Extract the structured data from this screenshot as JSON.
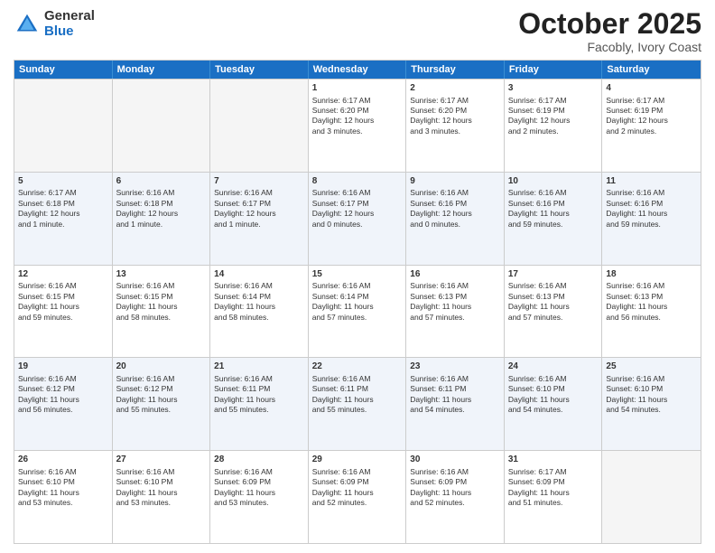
{
  "header": {
    "logo": {
      "general": "General",
      "blue": "Blue"
    },
    "title": "October 2025",
    "location": "Facobly, Ivory Coast"
  },
  "weekdays": [
    "Sunday",
    "Monday",
    "Tuesday",
    "Wednesday",
    "Thursday",
    "Friday",
    "Saturday"
  ],
  "rows": [
    [
      {
        "day": "",
        "empty": true
      },
      {
        "day": "",
        "empty": true
      },
      {
        "day": "",
        "empty": true
      },
      {
        "day": "1",
        "lines": [
          "Sunrise: 6:17 AM",
          "Sunset: 6:20 PM",
          "Daylight: 12 hours",
          "and 3 minutes."
        ]
      },
      {
        "day": "2",
        "lines": [
          "Sunrise: 6:17 AM",
          "Sunset: 6:20 PM",
          "Daylight: 12 hours",
          "and 3 minutes."
        ]
      },
      {
        "day": "3",
        "lines": [
          "Sunrise: 6:17 AM",
          "Sunset: 6:19 PM",
          "Daylight: 12 hours",
          "and 2 minutes."
        ]
      },
      {
        "day": "4",
        "lines": [
          "Sunrise: 6:17 AM",
          "Sunset: 6:19 PM",
          "Daylight: 12 hours",
          "and 2 minutes."
        ]
      }
    ],
    [
      {
        "day": "5",
        "lines": [
          "Sunrise: 6:17 AM",
          "Sunset: 6:18 PM",
          "Daylight: 12 hours",
          "and 1 minute."
        ]
      },
      {
        "day": "6",
        "lines": [
          "Sunrise: 6:16 AM",
          "Sunset: 6:18 PM",
          "Daylight: 12 hours",
          "and 1 minute."
        ]
      },
      {
        "day": "7",
        "lines": [
          "Sunrise: 6:16 AM",
          "Sunset: 6:17 PM",
          "Daylight: 12 hours",
          "and 1 minute."
        ]
      },
      {
        "day": "8",
        "lines": [
          "Sunrise: 6:16 AM",
          "Sunset: 6:17 PM",
          "Daylight: 12 hours",
          "and 0 minutes."
        ]
      },
      {
        "day": "9",
        "lines": [
          "Sunrise: 6:16 AM",
          "Sunset: 6:16 PM",
          "Daylight: 12 hours",
          "and 0 minutes."
        ]
      },
      {
        "day": "10",
        "lines": [
          "Sunrise: 6:16 AM",
          "Sunset: 6:16 PM",
          "Daylight: 11 hours",
          "and 59 minutes."
        ]
      },
      {
        "day": "11",
        "lines": [
          "Sunrise: 6:16 AM",
          "Sunset: 6:16 PM",
          "Daylight: 11 hours",
          "and 59 minutes."
        ]
      }
    ],
    [
      {
        "day": "12",
        "lines": [
          "Sunrise: 6:16 AM",
          "Sunset: 6:15 PM",
          "Daylight: 11 hours",
          "and 59 minutes."
        ]
      },
      {
        "day": "13",
        "lines": [
          "Sunrise: 6:16 AM",
          "Sunset: 6:15 PM",
          "Daylight: 11 hours",
          "and 58 minutes."
        ]
      },
      {
        "day": "14",
        "lines": [
          "Sunrise: 6:16 AM",
          "Sunset: 6:14 PM",
          "Daylight: 11 hours",
          "and 58 minutes."
        ]
      },
      {
        "day": "15",
        "lines": [
          "Sunrise: 6:16 AM",
          "Sunset: 6:14 PM",
          "Daylight: 11 hours",
          "and 57 minutes."
        ]
      },
      {
        "day": "16",
        "lines": [
          "Sunrise: 6:16 AM",
          "Sunset: 6:13 PM",
          "Daylight: 11 hours",
          "and 57 minutes."
        ]
      },
      {
        "day": "17",
        "lines": [
          "Sunrise: 6:16 AM",
          "Sunset: 6:13 PM",
          "Daylight: 11 hours",
          "and 57 minutes."
        ]
      },
      {
        "day": "18",
        "lines": [
          "Sunrise: 6:16 AM",
          "Sunset: 6:13 PM",
          "Daylight: 11 hours",
          "and 56 minutes."
        ]
      }
    ],
    [
      {
        "day": "19",
        "lines": [
          "Sunrise: 6:16 AM",
          "Sunset: 6:12 PM",
          "Daylight: 11 hours",
          "and 56 minutes."
        ]
      },
      {
        "day": "20",
        "lines": [
          "Sunrise: 6:16 AM",
          "Sunset: 6:12 PM",
          "Daylight: 11 hours",
          "and 55 minutes."
        ]
      },
      {
        "day": "21",
        "lines": [
          "Sunrise: 6:16 AM",
          "Sunset: 6:11 PM",
          "Daylight: 11 hours",
          "and 55 minutes."
        ]
      },
      {
        "day": "22",
        "lines": [
          "Sunrise: 6:16 AM",
          "Sunset: 6:11 PM",
          "Daylight: 11 hours",
          "and 55 minutes."
        ]
      },
      {
        "day": "23",
        "lines": [
          "Sunrise: 6:16 AM",
          "Sunset: 6:11 PM",
          "Daylight: 11 hours",
          "and 54 minutes."
        ]
      },
      {
        "day": "24",
        "lines": [
          "Sunrise: 6:16 AM",
          "Sunset: 6:10 PM",
          "Daylight: 11 hours",
          "and 54 minutes."
        ]
      },
      {
        "day": "25",
        "lines": [
          "Sunrise: 6:16 AM",
          "Sunset: 6:10 PM",
          "Daylight: 11 hours",
          "and 54 minutes."
        ]
      }
    ],
    [
      {
        "day": "26",
        "lines": [
          "Sunrise: 6:16 AM",
          "Sunset: 6:10 PM",
          "Daylight: 11 hours",
          "and 53 minutes."
        ]
      },
      {
        "day": "27",
        "lines": [
          "Sunrise: 6:16 AM",
          "Sunset: 6:10 PM",
          "Daylight: 11 hours",
          "and 53 minutes."
        ]
      },
      {
        "day": "28",
        "lines": [
          "Sunrise: 6:16 AM",
          "Sunset: 6:09 PM",
          "Daylight: 11 hours",
          "and 53 minutes."
        ]
      },
      {
        "day": "29",
        "lines": [
          "Sunrise: 6:16 AM",
          "Sunset: 6:09 PM",
          "Daylight: 11 hours",
          "and 52 minutes."
        ]
      },
      {
        "day": "30",
        "lines": [
          "Sunrise: 6:16 AM",
          "Sunset: 6:09 PM",
          "Daylight: 11 hours",
          "and 52 minutes."
        ]
      },
      {
        "day": "31",
        "lines": [
          "Sunrise: 6:17 AM",
          "Sunset: 6:09 PM",
          "Daylight: 11 hours",
          "and 51 minutes."
        ]
      },
      {
        "day": "",
        "empty": true
      }
    ]
  ]
}
